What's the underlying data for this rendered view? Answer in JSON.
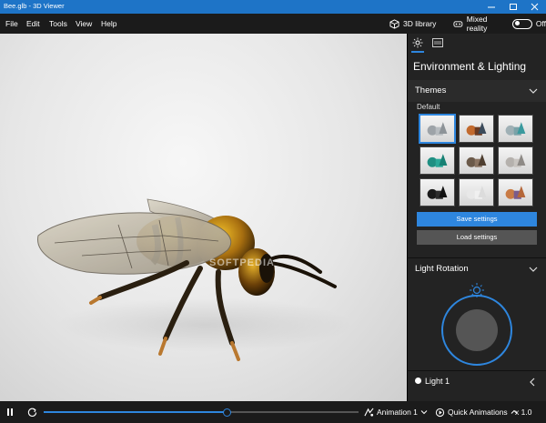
{
  "app": {
    "title": "Bee.glb - 3D Viewer",
    "accent_color": "#2e86de"
  },
  "menu": {
    "items": [
      "File",
      "Edit",
      "Tools",
      "View",
      "Help"
    ],
    "library_label": "3D library",
    "mixed_reality_label": "Mixed reality",
    "mixed_reality_state": "Off"
  },
  "watermark": "SOFTPEDIA",
  "panel": {
    "title": "Environment & Lighting",
    "themes": {
      "heading": "Themes",
      "subheading": "Default",
      "selected_index": 0,
      "items": [
        {
          "name": "default-gray"
        },
        {
          "name": "warm-orange"
        },
        {
          "name": "teal-gray"
        },
        {
          "name": "teal"
        },
        {
          "name": "brown"
        },
        {
          "name": "soft-gray"
        },
        {
          "name": "dark"
        },
        {
          "name": "white"
        },
        {
          "name": "copper-purple"
        }
      ]
    },
    "save_label": "Save settings",
    "load_label": "Load settings",
    "rotation_heading": "Light Rotation",
    "light_label": "Light 1"
  },
  "bottom": {
    "animation_label": "Animation 1",
    "quick_label": "Quick Animations",
    "speed_label": "x 1.0"
  }
}
